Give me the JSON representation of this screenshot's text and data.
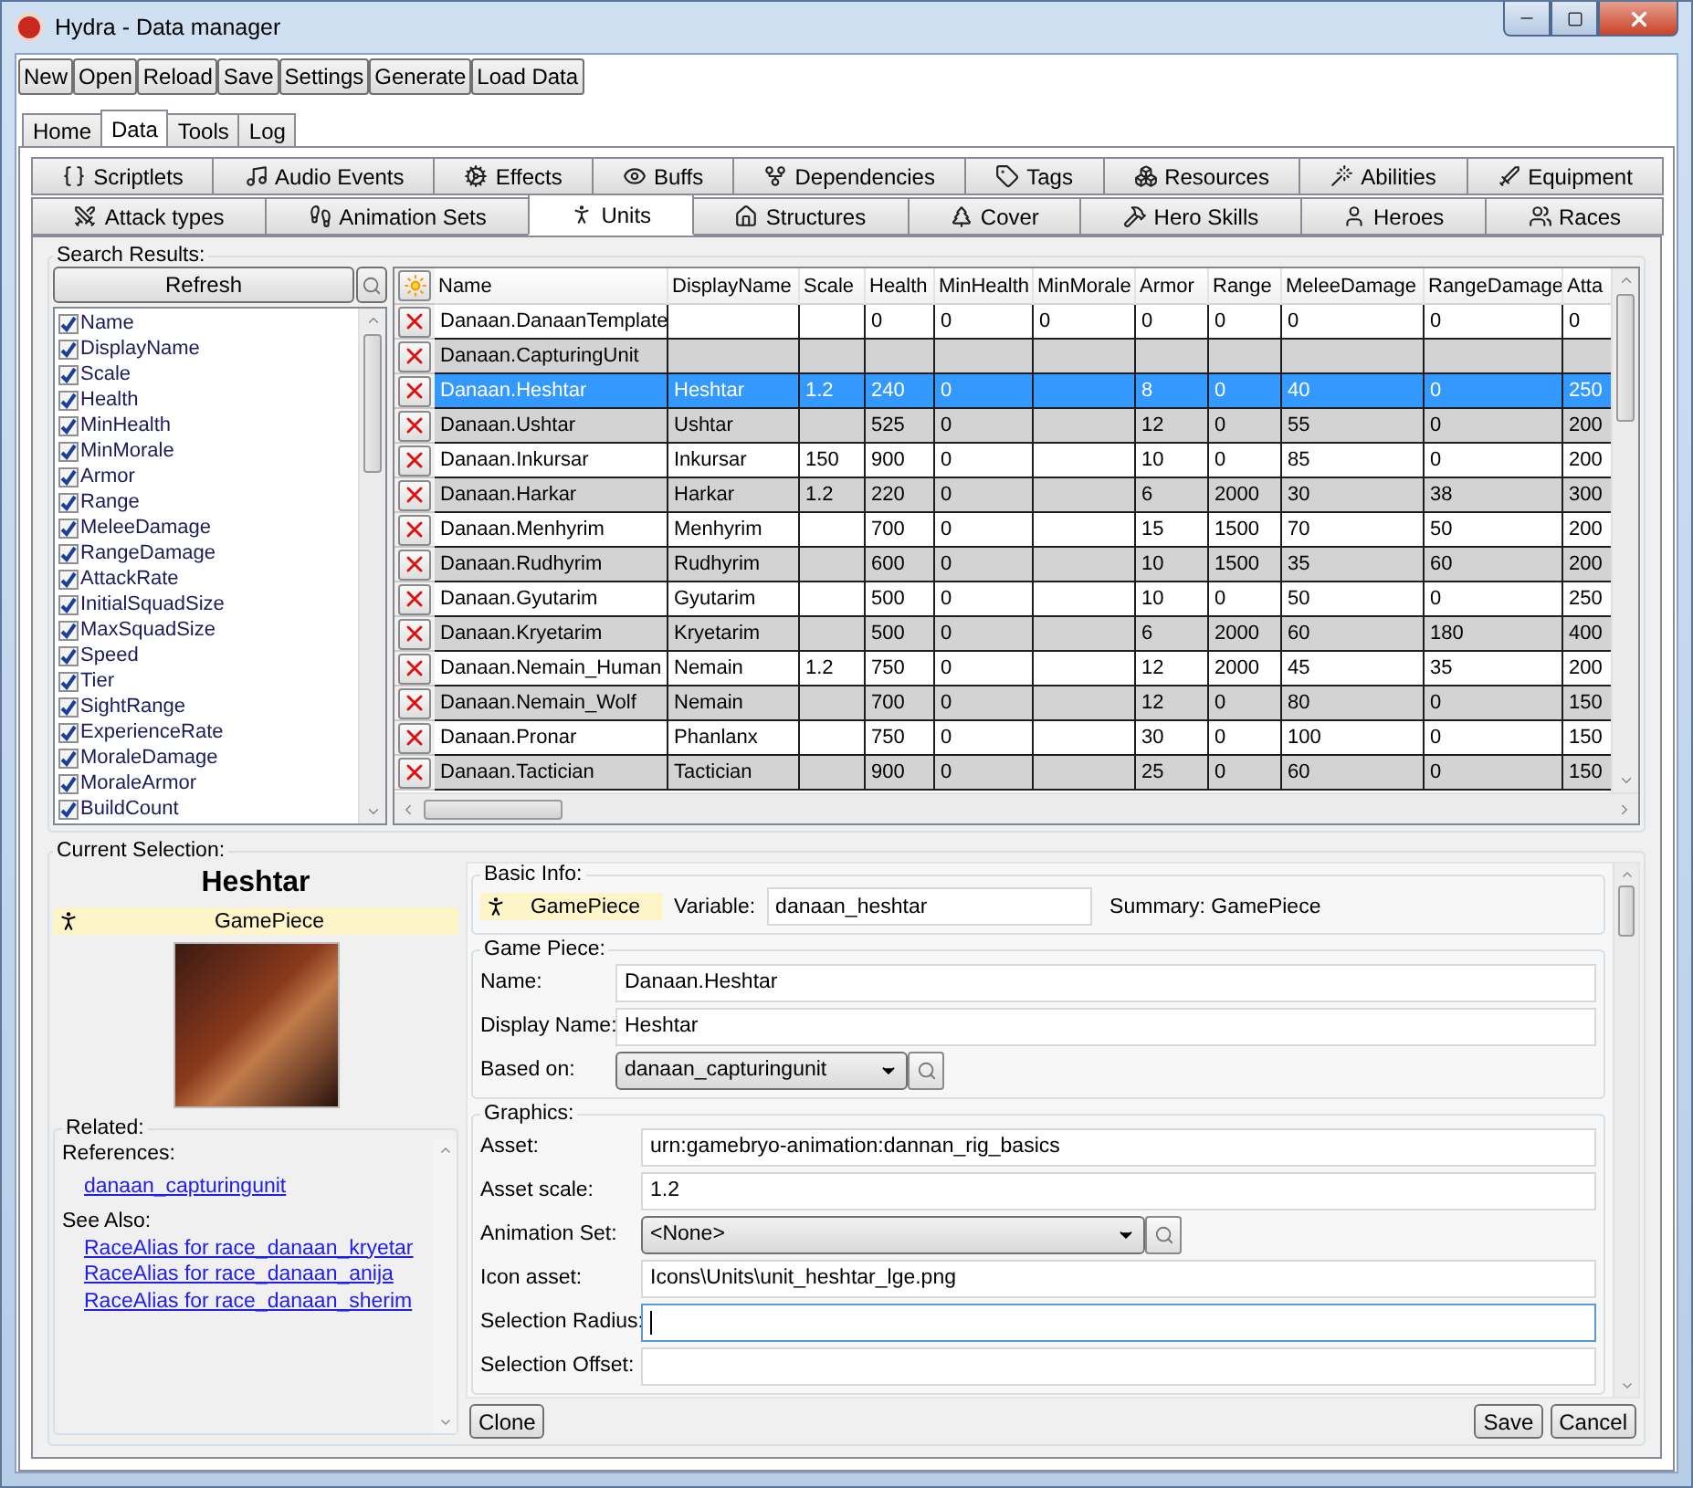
{
  "window": {
    "title": "Hydra - Data manager"
  },
  "toolbar": [
    "New",
    "Open",
    "Reload",
    "Save",
    "Settings",
    "Generate",
    "Load Data"
  ],
  "main_tabs": [
    {
      "label": "Home",
      "selected": false
    },
    {
      "label": "Data",
      "selected": true
    },
    {
      "label": "Tools",
      "selected": false
    },
    {
      "label": "Log",
      "selected": false
    }
  ],
  "data_tabs": {
    "row_1": [
      {
        "label": "Scriptlets",
        "selected": false
      },
      {
        "label": "Audio Events",
        "selected": false
      },
      {
        "label": "Effects",
        "selected": false
      },
      {
        "label": "Buffs",
        "selected": false
      },
      {
        "label": "Dependencies",
        "selected": false
      },
      {
        "label": "Tags",
        "selected": false
      },
      {
        "label": "Resources",
        "selected": false
      },
      {
        "label": "Abilities",
        "selected": false
      },
      {
        "label": "Equipment",
        "selected": false
      }
    ],
    "row_2": [
      {
        "label": "Attack types",
        "selected": false
      },
      {
        "label": "Animation Sets",
        "selected": false
      },
      {
        "label": "Units",
        "selected": true
      },
      {
        "label": "Structures",
        "selected": false
      },
      {
        "label": "Cover",
        "selected": false
      },
      {
        "label": "Hero Skills",
        "selected": false
      },
      {
        "label": "Heroes",
        "selected": false
      },
      {
        "label": "Races",
        "selected": false
      }
    ]
  },
  "search_results": {
    "title": "Search Results:",
    "refresh_button": "Refresh",
    "fields": [
      {
        "label": "Name",
        "checked": true
      },
      {
        "label": "DisplayName",
        "checked": true
      },
      {
        "label": "Scale",
        "checked": true
      },
      {
        "label": "Health",
        "checked": true
      },
      {
        "label": "MinHealth",
        "checked": true
      },
      {
        "label": "MinMorale",
        "checked": true
      },
      {
        "label": "Armor",
        "checked": true
      },
      {
        "label": "Range",
        "checked": true
      },
      {
        "label": "MeleeDamage",
        "checked": true
      },
      {
        "label": "RangeDamage",
        "checked": true
      },
      {
        "label": "AttackRate",
        "checked": true
      },
      {
        "label": "InitialSquadSize",
        "checked": true
      },
      {
        "label": "MaxSquadSize",
        "checked": true
      },
      {
        "label": "Speed",
        "checked": true
      },
      {
        "label": "Tier",
        "checked": true
      },
      {
        "label": "SightRange",
        "checked": true
      },
      {
        "label": "ExperienceRate",
        "checked": true
      },
      {
        "label": "MoraleDamage",
        "checked": true
      },
      {
        "label": "MoraleArmor",
        "checked": true
      },
      {
        "label": "BuildCount",
        "checked": true
      }
    ]
  },
  "table": {
    "columns": [
      "Name",
      "DisplayName",
      "Scale",
      "Health",
      "MinHealth",
      "MinMorale",
      "Armor",
      "Range",
      "MeleeDamage",
      "RangeDamage",
      "Atta"
    ],
    "rows": [
      {
        "selected": false,
        "cells": [
          "Danaan.DanaanTemplate",
          null,
          null,
          "0",
          "0",
          "0",
          "0",
          "0",
          "0",
          "0",
          "0"
        ]
      },
      {
        "selected": false,
        "cells": [
          "Danaan.CapturingUnit",
          null,
          null,
          null,
          null,
          null,
          null,
          null,
          null,
          null,
          null
        ]
      },
      {
        "selected": true,
        "cells": [
          "Danaan.Heshtar",
          "Heshtar",
          "1.2",
          "240",
          "0",
          null,
          "8",
          "0",
          "40",
          "0",
          "250"
        ]
      },
      {
        "selected": false,
        "cells": [
          "Danaan.Ushtar",
          "Ushtar",
          null,
          "525",
          "0",
          null,
          "12",
          "0",
          "55",
          "0",
          "200"
        ]
      },
      {
        "selected": false,
        "cells": [
          "Danaan.Inkursar",
          "Inkursar",
          "150",
          "900",
          "0",
          null,
          "10",
          "0",
          "85",
          "0",
          "200"
        ]
      },
      {
        "selected": false,
        "cells": [
          "Danaan.Harkar",
          "Harkar",
          "1.2",
          "220",
          "0",
          null,
          "6",
          "2000",
          "30",
          "38",
          "300"
        ]
      },
      {
        "selected": false,
        "cells": [
          "Danaan.Menhyrim",
          "Menhyrim",
          null,
          "700",
          "0",
          null,
          "15",
          "1500",
          "70",
          "50",
          "200"
        ]
      },
      {
        "selected": false,
        "cells": [
          "Danaan.Rudhyrim",
          "Rudhyrim",
          null,
          "600",
          "0",
          null,
          "10",
          "1500",
          "35",
          "60",
          "200"
        ]
      },
      {
        "selected": false,
        "cells": [
          "Danaan.Gyutarim",
          "Gyutarim",
          null,
          "500",
          "0",
          null,
          "10",
          "0",
          "50",
          "0",
          "250"
        ]
      },
      {
        "selected": false,
        "cells": [
          "Danaan.Kryetarim",
          "Kryetarim",
          null,
          "500",
          "0",
          null,
          "6",
          "2000",
          "60",
          "180",
          "400"
        ]
      },
      {
        "selected": false,
        "cells": [
          "Danaan.Nemain_Human",
          "Nemain",
          "1.2",
          "750",
          "0",
          null,
          "12",
          "2000",
          "45",
          "35",
          "200"
        ]
      },
      {
        "selected": false,
        "cells": [
          "Danaan.Nemain_Wolf",
          "Nemain",
          null,
          "700",
          "0",
          null,
          "12",
          "0",
          "80",
          "0",
          "150"
        ]
      },
      {
        "selected": false,
        "cells": [
          "Danaan.Pronar",
          "Phanlanx",
          null,
          "750",
          "0",
          null,
          "30",
          "0",
          "100",
          "0",
          "150"
        ]
      },
      {
        "selected": false,
        "cells": [
          "Danaan.Tactician",
          "Tactician",
          null,
          "900",
          "0",
          null,
          "25",
          "0",
          "60",
          "0",
          "150"
        ]
      }
    ]
  },
  "current_selection": {
    "title": "Current Selection:",
    "heading": "Heshtar",
    "type_label": "GamePiece",
    "related": {
      "title": "Related:",
      "references_label": "References:",
      "references": [
        "danaan_capturingunit"
      ],
      "see_also_label": "See Also:",
      "see_also": [
        "RaceAlias for race_danaan_kryetar",
        "RaceAlias for race_danaan_anija",
        "RaceAlias for race_danaan_sherim"
      ]
    }
  },
  "details": {
    "basic_info": {
      "title": "Basic Info:",
      "type_label": "GamePiece",
      "variable_label": "Variable:",
      "variable": "danaan_heshtar",
      "summary": "Summary: GamePiece"
    },
    "game_piece": {
      "title": "Game Piece:",
      "fields": [
        {
          "kind": "text",
          "label": "Name:",
          "value": "Danaan.Heshtar",
          "focused": false
        },
        {
          "kind": "text",
          "label": "Display Name:",
          "value": "Heshtar",
          "focused": false
        },
        {
          "kind": "select",
          "label": "Based on:",
          "value": "danaan_capturingunit",
          "focused": false
        }
      ]
    },
    "graphics": {
      "title": "Graphics:",
      "fields": [
        {
          "kind": "text",
          "label": "Asset:",
          "value": "urn:gamebryo-animation:dannan_rig_basics",
          "focused": false
        },
        {
          "kind": "text",
          "label": "Asset scale:",
          "value": "1.2",
          "focused": false
        },
        {
          "kind": "select",
          "label": "Animation Set:",
          "value": "<None>",
          "focused": false
        },
        {
          "kind": "text",
          "label": "Icon asset:",
          "value": "Icons\\Units\\unit_heshtar_lge.png",
          "focused": false
        },
        {
          "kind": "text",
          "label": "Selection Radius:",
          "focused": true
        },
        {
          "kind": "text",
          "label": "Selection Offset:",
          "focused": false
        }
      ]
    }
  },
  "buttons": {
    "clone": "Clone",
    "save": "Save",
    "cancel": "Cancel"
  }
}
